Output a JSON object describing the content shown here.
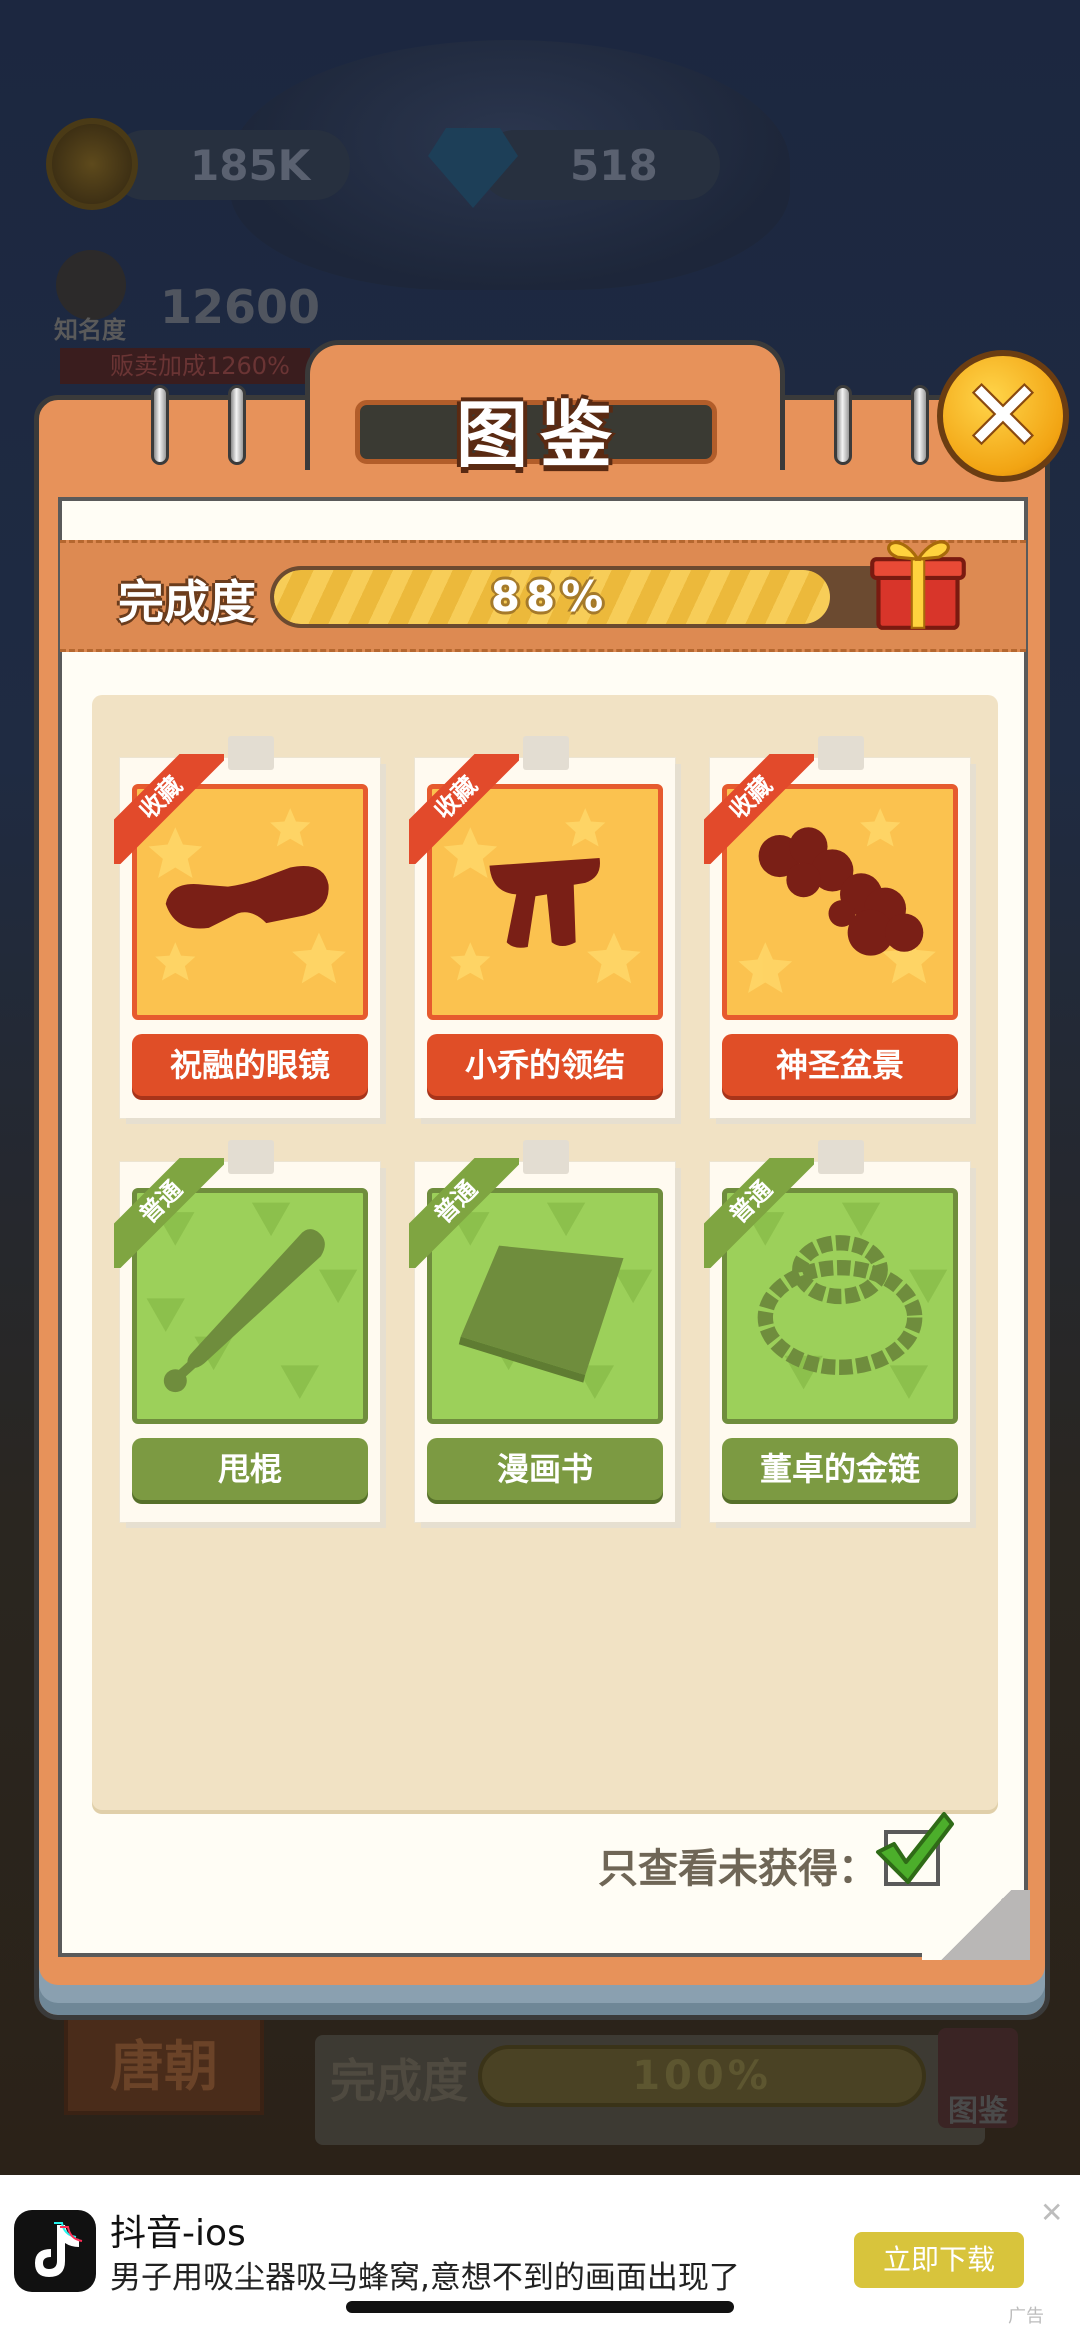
{
  "hud": {
    "coins": "185K",
    "gems": "518",
    "fame_label": "知名度",
    "fame_value": "12600",
    "fame_bonus": "贩卖加成1260%"
  },
  "background": {
    "dynasty_tab": "唐朝",
    "completion_label": "完成度",
    "completion_value": "100%",
    "book_label": "图鉴"
  },
  "modal": {
    "title": "图鉴",
    "close_symbol": "✕",
    "progress": {
      "label": "完成度",
      "value_text": "88%",
      "fraction": 0.88
    },
    "items": [
      {
        "name": "祝融的眼镜",
        "tag": "收藏",
        "rarity": "rare",
        "art": "glasses-silhouette"
      },
      {
        "name": "小乔的领结",
        "tag": "收藏",
        "rarity": "rare",
        "art": "bowtie-silhouette"
      },
      {
        "name": "神圣盆景",
        "tag": "收藏",
        "rarity": "rare",
        "art": "bonsai-silhouette"
      },
      {
        "name": "甩棍",
        "tag": "普通",
        "rarity": "common",
        "art": "baton-silhouette"
      },
      {
        "name": "漫画书",
        "tag": "普通",
        "rarity": "common",
        "art": "comic-book-silhouette"
      },
      {
        "name": "董卓的金链",
        "tag": "普通",
        "rarity": "common",
        "art": "gold-chain-silhouette"
      }
    ],
    "filter_label": "只查看未获得：",
    "filter_checked": true
  },
  "ad": {
    "app_name": "抖音-ios",
    "description": "男子用吸尘器吸马蜂窝,意想不到的画面出现了",
    "cta": "立即下载",
    "close_symbol": "✕",
    "tag": "广告"
  },
  "colors": {
    "rare_accent": "#e04e27",
    "common_accent": "#7c9a42",
    "modal_orange": "#e7925a",
    "progress_yellow": "#f7cd58"
  }
}
